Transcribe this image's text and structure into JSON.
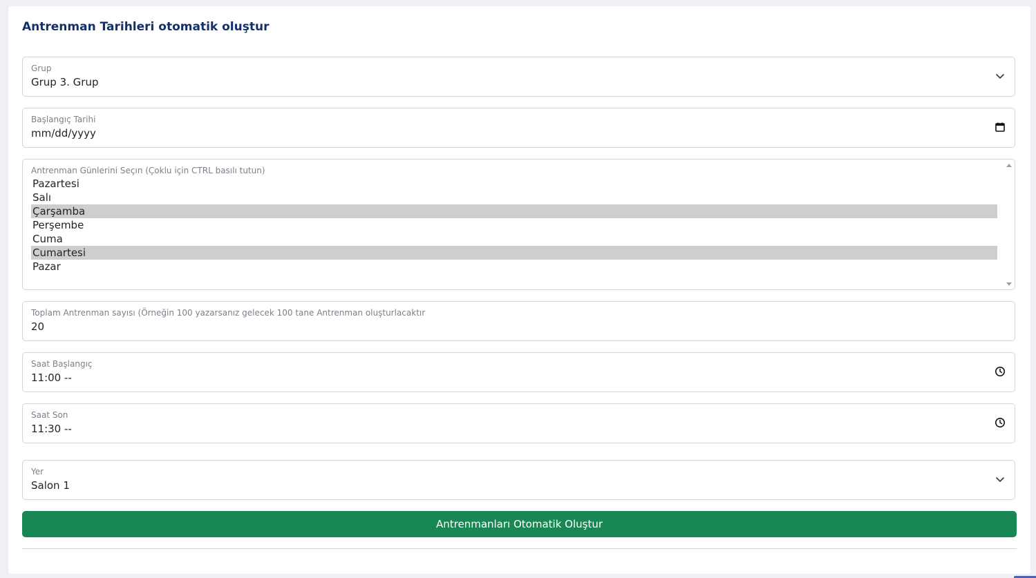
{
  "form": {
    "title": "Antrenman Tarihleri otomatik oluştur",
    "group": {
      "label": "Grup",
      "value": "Grup 3. Grup",
      "icon": "chevron-down-icon"
    },
    "start_date": {
      "label": "Başlangıç Tarihi",
      "value": "mm/dd/yyyy",
      "icon": "calendar-icon"
    },
    "days": {
      "label": "Antrenman Günlerini Seçın (Çoklu için CTRL basılı tutun)",
      "options": [
        {
          "label": "Pazartesi",
          "selected": false
        },
        {
          "label": "Salı",
          "selected": false
        },
        {
          "label": "Çarşamba",
          "selected": true
        },
        {
          "label": "Perşembe",
          "selected": false
        },
        {
          "label": "Cuma",
          "selected": false
        },
        {
          "label": "Cumartesi",
          "selected": true
        },
        {
          "label": "Pazar",
          "selected": false
        }
      ]
    },
    "total": {
      "label": "Toplam Antrenman sayısı (Örneğin 100 yazarsanız gelecek 100 tane Antrenman oluşturlacaktır",
      "value": "20"
    },
    "time_start": {
      "label": "Saat Başlangıç",
      "value": "11:00 --",
      "icon": "clock-icon"
    },
    "time_end": {
      "label": "Saat Son",
      "value": "11:30 --",
      "icon": "clock-icon"
    },
    "place": {
      "label": "Yer",
      "value": "Salon 1",
      "icon": "chevron-down-icon"
    },
    "submit_label": "Antrenmanları Otomatik Oluştur"
  },
  "colors": {
    "title": "#12306a",
    "button": "#198754",
    "selected_option": "#cecece",
    "border": "#d2d5da"
  }
}
